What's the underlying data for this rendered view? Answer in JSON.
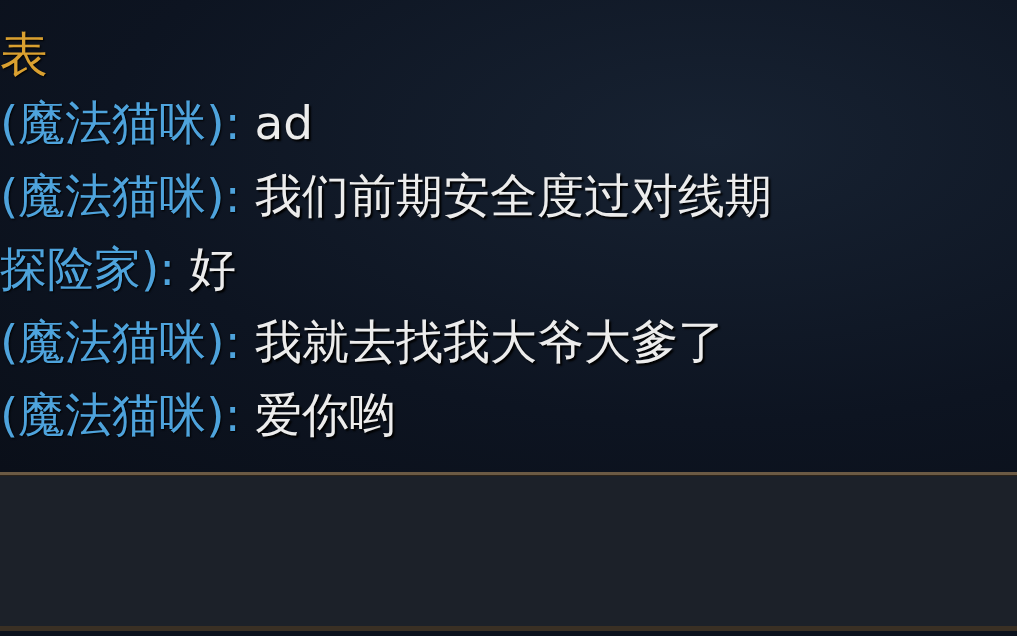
{
  "chat_panel": {
    "title": "表",
    "messages": [
      {
        "sender": "(魔法猫咪):",
        "text": "ad"
      },
      {
        "sender": "(魔法猫咪):",
        "text": "我们前期安全度过对线期"
      },
      {
        "sender": "探险家):",
        "text": "好"
      },
      {
        "sender": "(魔法猫咪):",
        "text": "我就去找我大爷大爹了"
      },
      {
        "sender": "(魔法猫咪):",
        "text": "爱你哟"
      }
    ]
  }
}
